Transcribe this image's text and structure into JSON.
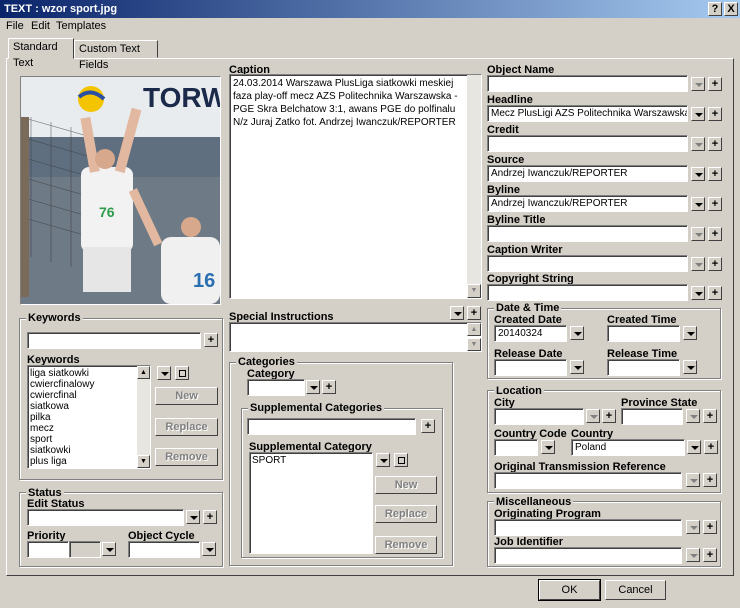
{
  "window": {
    "title": "TEXT : wzor sport.jpg",
    "help_btn": "?",
    "close_btn": "X"
  },
  "menu": [
    "File",
    "Edit",
    "Templates"
  ],
  "tabs": [
    "Standard Text",
    "Custom Text Fields"
  ],
  "caption": {
    "label": "Caption",
    "text": "24.03.2014 Warszawa PlusLiga siatkowki meskiej faza play-off mecz AZS Politechnika Warszawska - PGE Skra Belchatow 3:1, awans PGE do polfinalu N/z Juraj Zatko fot. Andrzej Iwanczuk/REPORTER"
  },
  "special_instructions": {
    "label": "Special Instructions",
    "value": ""
  },
  "keywords": {
    "group_label": "Keywords",
    "input_value": "",
    "list_label": "Keywords",
    "items": [
      "liga siatkowki",
      "cwiercfinalowy",
      "cwiercfinal",
      "siatkowa",
      "pilka",
      "mecz",
      "sport",
      "siatkowki",
      "plus liga"
    ],
    "new_btn": "New",
    "replace_btn": "Replace",
    "remove_btn": "Remove"
  },
  "status": {
    "group_label": "Status",
    "edit_status_label": "Edit Status",
    "edit_status_value": "",
    "priority_label": "Priority",
    "object_cycle_label": "Object Cycle"
  },
  "categories": {
    "group_label": "Categories",
    "category_label": "Category",
    "category_value": "",
    "supp_group_label": "Supplemental Categories",
    "supp_input_value": "",
    "supp_list_label": "Supplemental Category",
    "supp_items": [
      "SPORT"
    ],
    "new_btn": "New",
    "replace_btn": "Replace",
    "remove_btn": "Remove"
  },
  "fields": {
    "object_name": {
      "label": "Object Name",
      "value": ""
    },
    "headline": {
      "label": "Headline",
      "value": "Mecz PlusLigi AZS Politechnika Warszawska - PG"
    },
    "credit": {
      "label": "Credit",
      "value": ""
    },
    "source": {
      "label": "Source",
      "value": "Andrzej Iwanczuk/REPORTER"
    },
    "byline": {
      "label": "Byline",
      "value": "Andrzej Iwanczuk/REPORTER"
    },
    "byline_title": {
      "label": "Byline Title",
      "value": ""
    },
    "caption_writer": {
      "label": "Caption Writer",
      "value": ""
    },
    "copyright": {
      "label": "Copyright String",
      "value": ""
    }
  },
  "datetime": {
    "group_label": "Date & Time",
    "created_date_label": "Created Date",
    "created_date_value": "20140324",
    "created_time_label": "Created Time",
    "created_time_value": "",
    "release_date_label": "Release Date",
    "release_date_value": "",
    "release_time_label": "Release Time",
    "release_time_value": ""
  },
  "location": {
    "group_label": "Location",
    "city_label": "City",
    "city_value": "",
    "province_label": "Province State",
    "province_value": "",
    "country_code_label": "Country Code",
    "country_code_value": "",
    "country_label": "Country",
    "country_value": "Poland",
    "otr_label": "Original Transmission Reference",
    "otr_value": ""
  },
  "misc": {
    "group_label": "Miscellaneous",
    "orig_program_label": "Originating Program",
    "orig_program_value": "",
    "job_id_label": "Job Identifier",
    "job_id_value": ""
  },
  "footer": {
    "ok": "OK",
    "cancel": "Cancel"
  },
  "symbols": {
    "plus": "+",
    "up": "▲",
    "down": "▼"
  },
  "photo": {
    "banner_text": "TORWA",
    "player1_number": "76",
    "player2_number": "16"
  }
}
